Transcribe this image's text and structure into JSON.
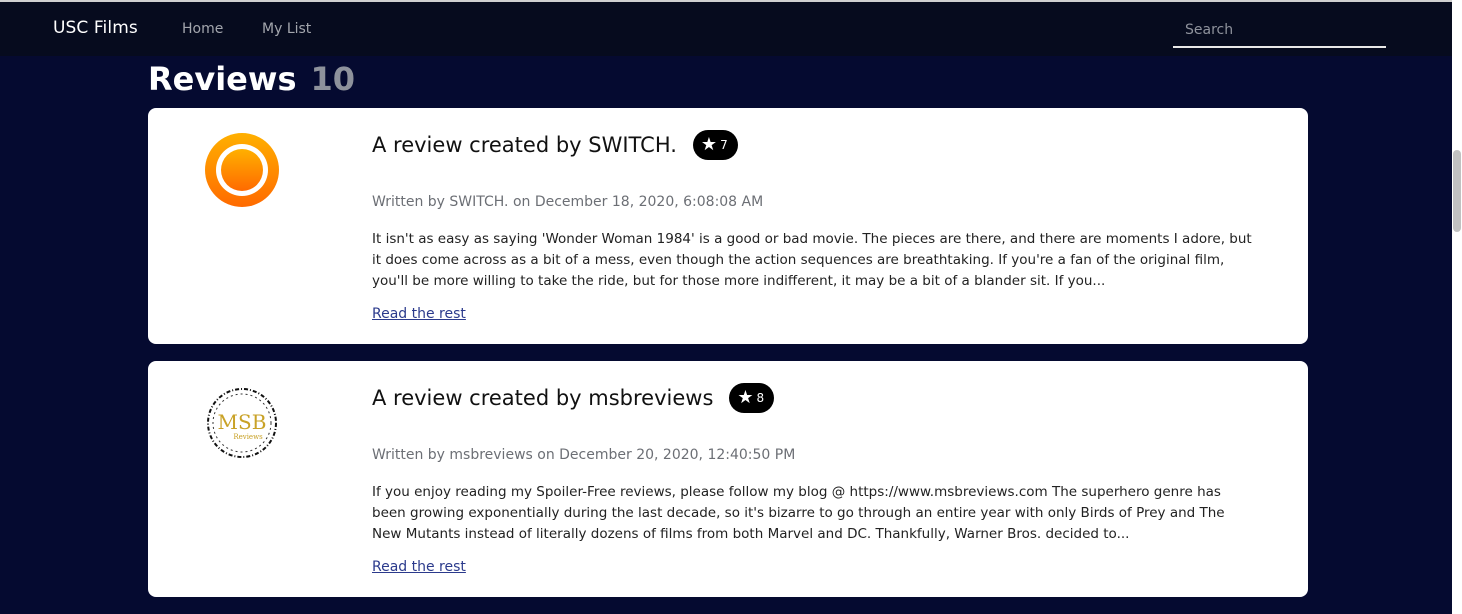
{
  "nav": {
    "brand": "USC Films",
    "links": [
      "Home",
      "My List"
    ],
    "search_placeholder": "Search"
  },
  "page": {
    "title": "Reviews",
    "count": "10"
  },
  "reviews": [
    {
      "title": "A review created by SWITCH.",
      "rating": "7",
      "byline": "Written by SWITCH. on December 18, 2020, 6:08:08 AM",
      "excerpt": "It isn't as easy as saying 'Wonder Woman 1984' is a good or bad movie. The pieces are there, and there are moments I adore, but it does come across as a bit of a mess, even though the action sequences are breathtaking. If you're a fan of the original film, you'll be more willing to take the ride, but for those more indifferent, it may be a bit of a blander sit. If you...",
      "read_more": "Read the rest",
      "avatar_icon": "orange-ring-avatar-icon"
    },
    {
      "title": "A review created by msbreviews",
      "rating": "8",
      "byline": "Written by msbreviews on December 20, 2020, 12:40:50 PM",
      "excerpt": "If you enjoy reading my Spoiler-Free reviews, please follow my blog @ https://www.msbreviews.com The superhero genre has been growing exponentially during the last decade, so it's bizarre to go through an entire year with only Birds of Prey and The New Mutants instead of literally dozens of films from both Marvel and DC. Thankfully, Warner Bros. decided to...",
      "read_more": "Read the rest",
      "avatar_icon": "msb-logo-avatar-icon",
      "avatar_logo_text": "MSB",
      "avatar_logo_subtext": "Reviews"
    }
  ],
  "colors": {
    "background": "#050a30",
    "navbar": "#060b1e",
    "card": "#ffffff",
    "badge": "#000000",
    "link": "#2b3a8c"
  }
}
